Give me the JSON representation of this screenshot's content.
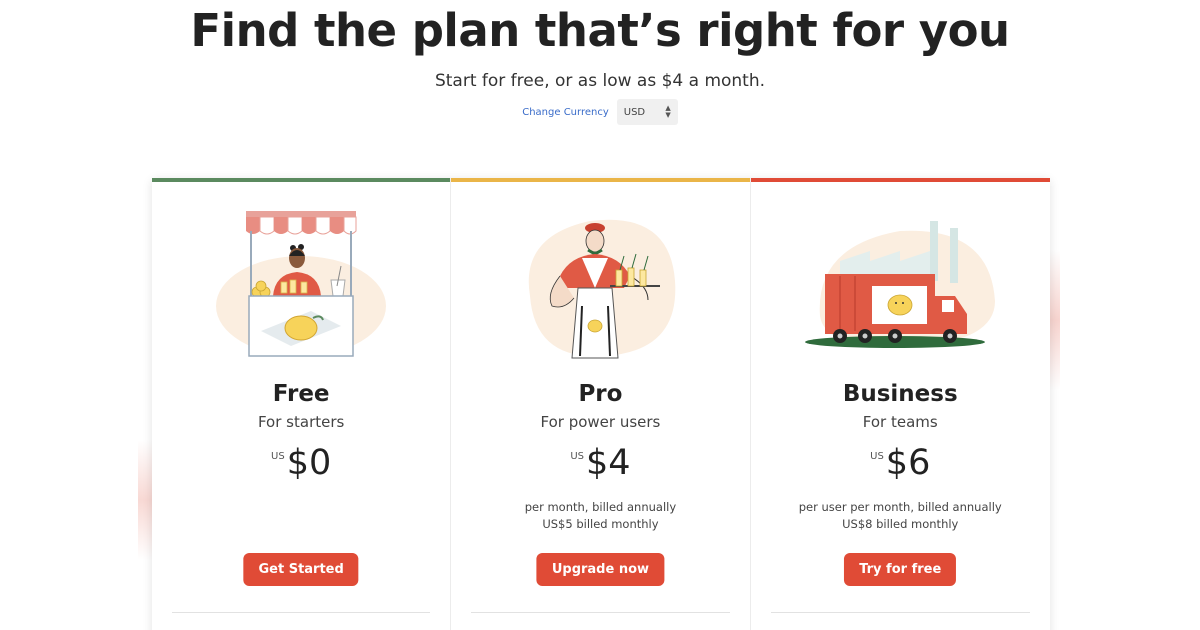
{
  "hero": {
    "title": "Find the plan that’s right for you",
    "subtitle": "Start for free, or as low as $4 a month."
  },
  "currency": {
    "link_label": "Change Currency",
    "selected": "USD"
  },
  "plans": [
    {
      "name": "Free",
      "tagline": "For starters",
      "currency_prefix": "US",
      "price": "$0",
      "billing_line1": "",
      "billing_line2": "",
      "cta": "Get Started",
      "accent": "#5b8a5f",
      "illustration": "lemonade-stand-illustration"
    },
    {
      "name": "Pro",
      "tagline": "For power users",
      "currency_prefix": "US",
      "price": "$4",
      "billing_line1": "per month, billed annually",
      "billing_line2": "US$5 billed monthly",
      "cta": "Upgrade now",
      "accent": "#eab548",
      "illustration": "waiter-illustration"
    },
    {
      "name": "Business",
      "tagline": "For teams",
      "currency_prefix": "US",
      "price": "$6",
      "billing_line1": "per user per month, billed annually",
      "billing_line2": "US$8 billed monthly",
      "cta": "Try for free",
      "accent": "#e04b36",
      "illustration": "delivery-truck-illustration"
    }
  ],
  "colors": {
    "cta": "#e04b36",
    "link": "#3a6cc9"
  }
}
